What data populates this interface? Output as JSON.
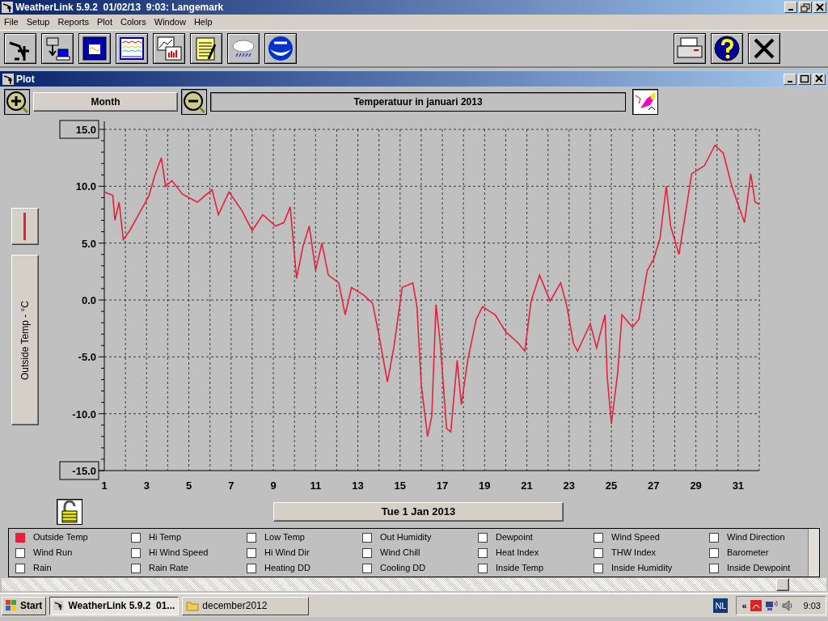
{
  "window": {
    "title": "WeatherLink 5.9.2  01/02/13  9:03: Langemark",
    "menu": [
      "File",
      "Setup",
      "Reports",
      "Plot",
      "Colors",
      "Window",
      "Help"
    ]
  },
  "plot_window": {
    "title": "Plot",
    "period_button": "Month",
    "plot_title": "Temperatuur in januari 2013",
    "axis_label": "Outside Temp - °C",
    "date_button": "Tue 1 Jan 2013",
    "chart_data": {
      "type": "line",
      "x": [
        1,
        1.4,
        1.5,
        1.7,
        1.9,
        2.2,
        2.8,
        3.1,
        3.4,
        3.7,
        3.9,
        4.2,
        4.7,
        5.4,
        6.1,
        6.4,
        6.9,
        7.5,
        8.0,
        8.5,
        9.1,
        9.5,
        9.8,
        10.1,
        10.4,
        10.7,
        11.0,
        11.3,
        11.6,
        12.1,
        12.4,
        12.7,
        13.3,
        13.7,
        14.0,
        14.4,
        14.7,
        15.1,
        15.6,
        15.8,
        16.0,
        16.3,
        16.5,
        16.7,
        16.9,
        17.2,
        17.4,
        17.7,
        17.9,
        18.2,
        18.6,
        18.9,
        19.5,
        20.0,
        20.6,
        20.9,
        21.2,
        21.6,
        22.1,
        22.6,
        22.9,
        23.2,
        23.4,
        24.0,
        24.3,
        24.7,
        24.8,
        25.0,
        25.3,
        25.5,
        26.0,
        26.3,
        26.7,
        27.0,
        27.3,
        27.6,
        27.8,
        28.2,
        28.5,
        28.8,
        29.4,
        29.9,
        30.3,
        30.7,
        31.3,
        31.6,
        31.8,
        32.0
      ],
      "series": [
        {
          "color": "#e8203c",
          "values": [
            9.5,
            9.2,
            7,
            8.6,
            5.3,
            6.1,
            8.1,
            9.1,
            11,
            12.5,
            10,
            10.5,
            9.3,
            8.6,
            9.7,
            7.5,
            9.5,
            7.9,
            6.1,
            7.5,
            6.5,
            6.8,
            8.2,
            1.9,
            4.7,
            6.5,
            2.6,
            5.0,
            2.2,
            1.5,
            -1.3,
            1.1,
            0.4,
            -0.3,
            -3.1,
            -7.2,
            -4.2,
            1.1,
            1.5,
            -0.6,
            -7.4,
            -12,
            -10.2,
            -0.4,
            -3.8,
            -11.3,
            -11.6,
            -5.3,
            -9.2,
            -5.3,
            -1.7,
            -0.6,
            -1.3,
            -2.8,
            -3.8,
            -4.5,
            -0.1,
            2.2,
            -0.1,
            1.5,
            -0.6,
            -3.8,
            -4.5,
            -2.1,
            -4.2,
            -1.3,
            -6.7,
            -10.9,
            -6.4,
            -1.3,
            -2.4,
            -1.7,
            2.6,
            3.6,
            5.4,
            10.0,
            6.5,
            4.0,
            7.5,
            11.1,
            11.8,
            13.6,
            12.9,
            10.0,
            6.8,
            11.1,
            8.6,
            8.4
          ]
        }
      ],
      "grid": true,
      "xlim": [
        1,
        32
      ],
      "ylim": [
        -15,
        15
      ],
      "xticks": [
        1,
        3,
        5,
        7,
        9,
        11,
        13,
        15,
        17,
        19,
        21,
        23,
        25,
        27,
        29,
        31
      ],
      "yticks": [
        {
          "value": -15,
          "label": "-15.0"
        },
        {
          "value": -10,
          "label": "-10.0"
        },
        {
          "value": -5,
          "label": "-5.0"
        },
        {
          "value": 0,
          "label": "0.0"
        },
        {
          "value": 5,
          "label": "5.0"
        },
        {
          "value": 10,
          "label": "10.0"
        },
        {
          "value": 15,
          "label": "15.0"
        }
      ]
    },
    "legend": [
      {
        "label": "Outside Temp",
        "checked": true
      },
      {
        "label": "Hi Temp",
        "checked": false
      },
      {
        "label": "Low Temp",
        "checked": false
      },
      {
        "label": "Out Humidity",
        "checked": false
      },
      {
        "label": "Dewpoint",
        "checked": false
      },
      {
        "label": "Wind Speed",
        "checked": false
      },
      {
        "label": "Wind Direction",
        "checked": false
      },
      {
        "label": "Wind Run",
        "checked": false
      },
      {
        "label": "Hi Wind Speed",
        "checked": false
      },
      {
        "label": "Hi Wind Dir",
        "checked": false
      },
      {
        "label": "Wind Chill",
        "checked": false
      },
      {
        "label": "Heat Index",
        "checked": false
      },
      {
        "label": "THW Index",
        "checked": false
      },
      {
        "label": "Barometer",
        "checked": false
      },
      {
        "label": "Rain",
        "checked": false
      },
      {
        "label": "Rain Rate",
        "checked": false
      },
      {
        "label": "Heating DD",
        "checked": false
      },
      {
        "label": "Cooling DD",
        "checked": false
      },
      {
        "label": "Inside Temp",
        "checked": false
      },
      {
        "label": "Inside Humidity",
        "checked": false
      },
      {
        "label": "Inside Dewpoint",
        "checked": false
      }
    ]
  },
  "taskbar": {
    "start": "Start",
    "tasks": [
      {
        "label": "WeatherLink 5.9.2  01...",
        "selected": true
      },
      {
        "label": "december2012",
        "selected": false
      }
    ],
    "language": "NL",
    "tray_expand": "«",
    "clock": "9:03"
  }
}
